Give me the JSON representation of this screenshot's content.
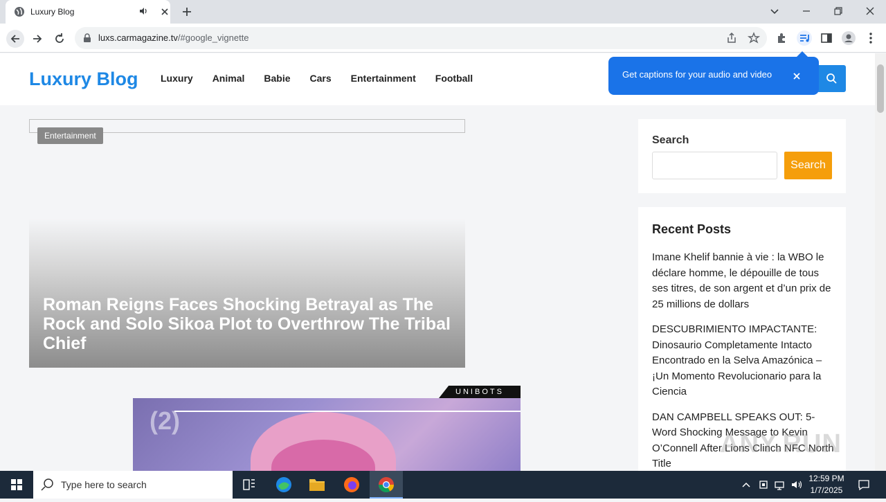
{
  "browser": {
    "tab_title": "Luxury Blog",
    "url_host": "luxs.carmagazine.tv",
    "url_path": "/#google_vignette"
  },
  "site": {
    "logo": "Luxury Blog",
    "menu": [
      "Luxury",
      "Animal",
      "Babie",
      "Cars",
      "Entertainment",
      "Football"
    ]
  },
  "feature": {
    "category": "Entertainment",
    "headline": "Roman Reigns Faces Shocking Betrayal as The Rock and Solo Sikoa Plot to Overthrow The Tribal Chief"
  },
  "ad": {
    "brand": "UNIBOTS",
    "badge": "(2)"
  },
  "sidebar": {
    "search_label": "Search",
    "search_button": "Search",
    "recent_heading": "Recent Posts",
    "recent_posts": [
      "Imane Khelif bannie à vie : la WBO le déclare homme, le dépouille de tous ses titres, de son argent et d’un prix de 25 millions de dollars",
      "DESCUBRIMIENTO IMPACTANTE: Dinosaurio Completamente Intacto Encontrado en la Selva Amazónica – ¡Un Momento Revolucionario para la Ciencia",
      "DAN CAMPBELL SPEAKS OUT: 5-Word Shocking Message to Kevin O’Connell After Lions Clinch NFC North Title"
    ]
  },
  "callout": {
    "text": "Get captions for your audio and video"
  },
  "watermark": "ANY.RUN",
  "taskbar": {
    "search_placeholder": "Type here to search",
    "time": "12:59 PM",
    "date": "1/7/2025"
  },
  "colors": {
    "brand_blue": "#1e88e5",
    "search_orange": "#f59e0b",
    "chrome_blue": "#1a73e8"
  }
}
